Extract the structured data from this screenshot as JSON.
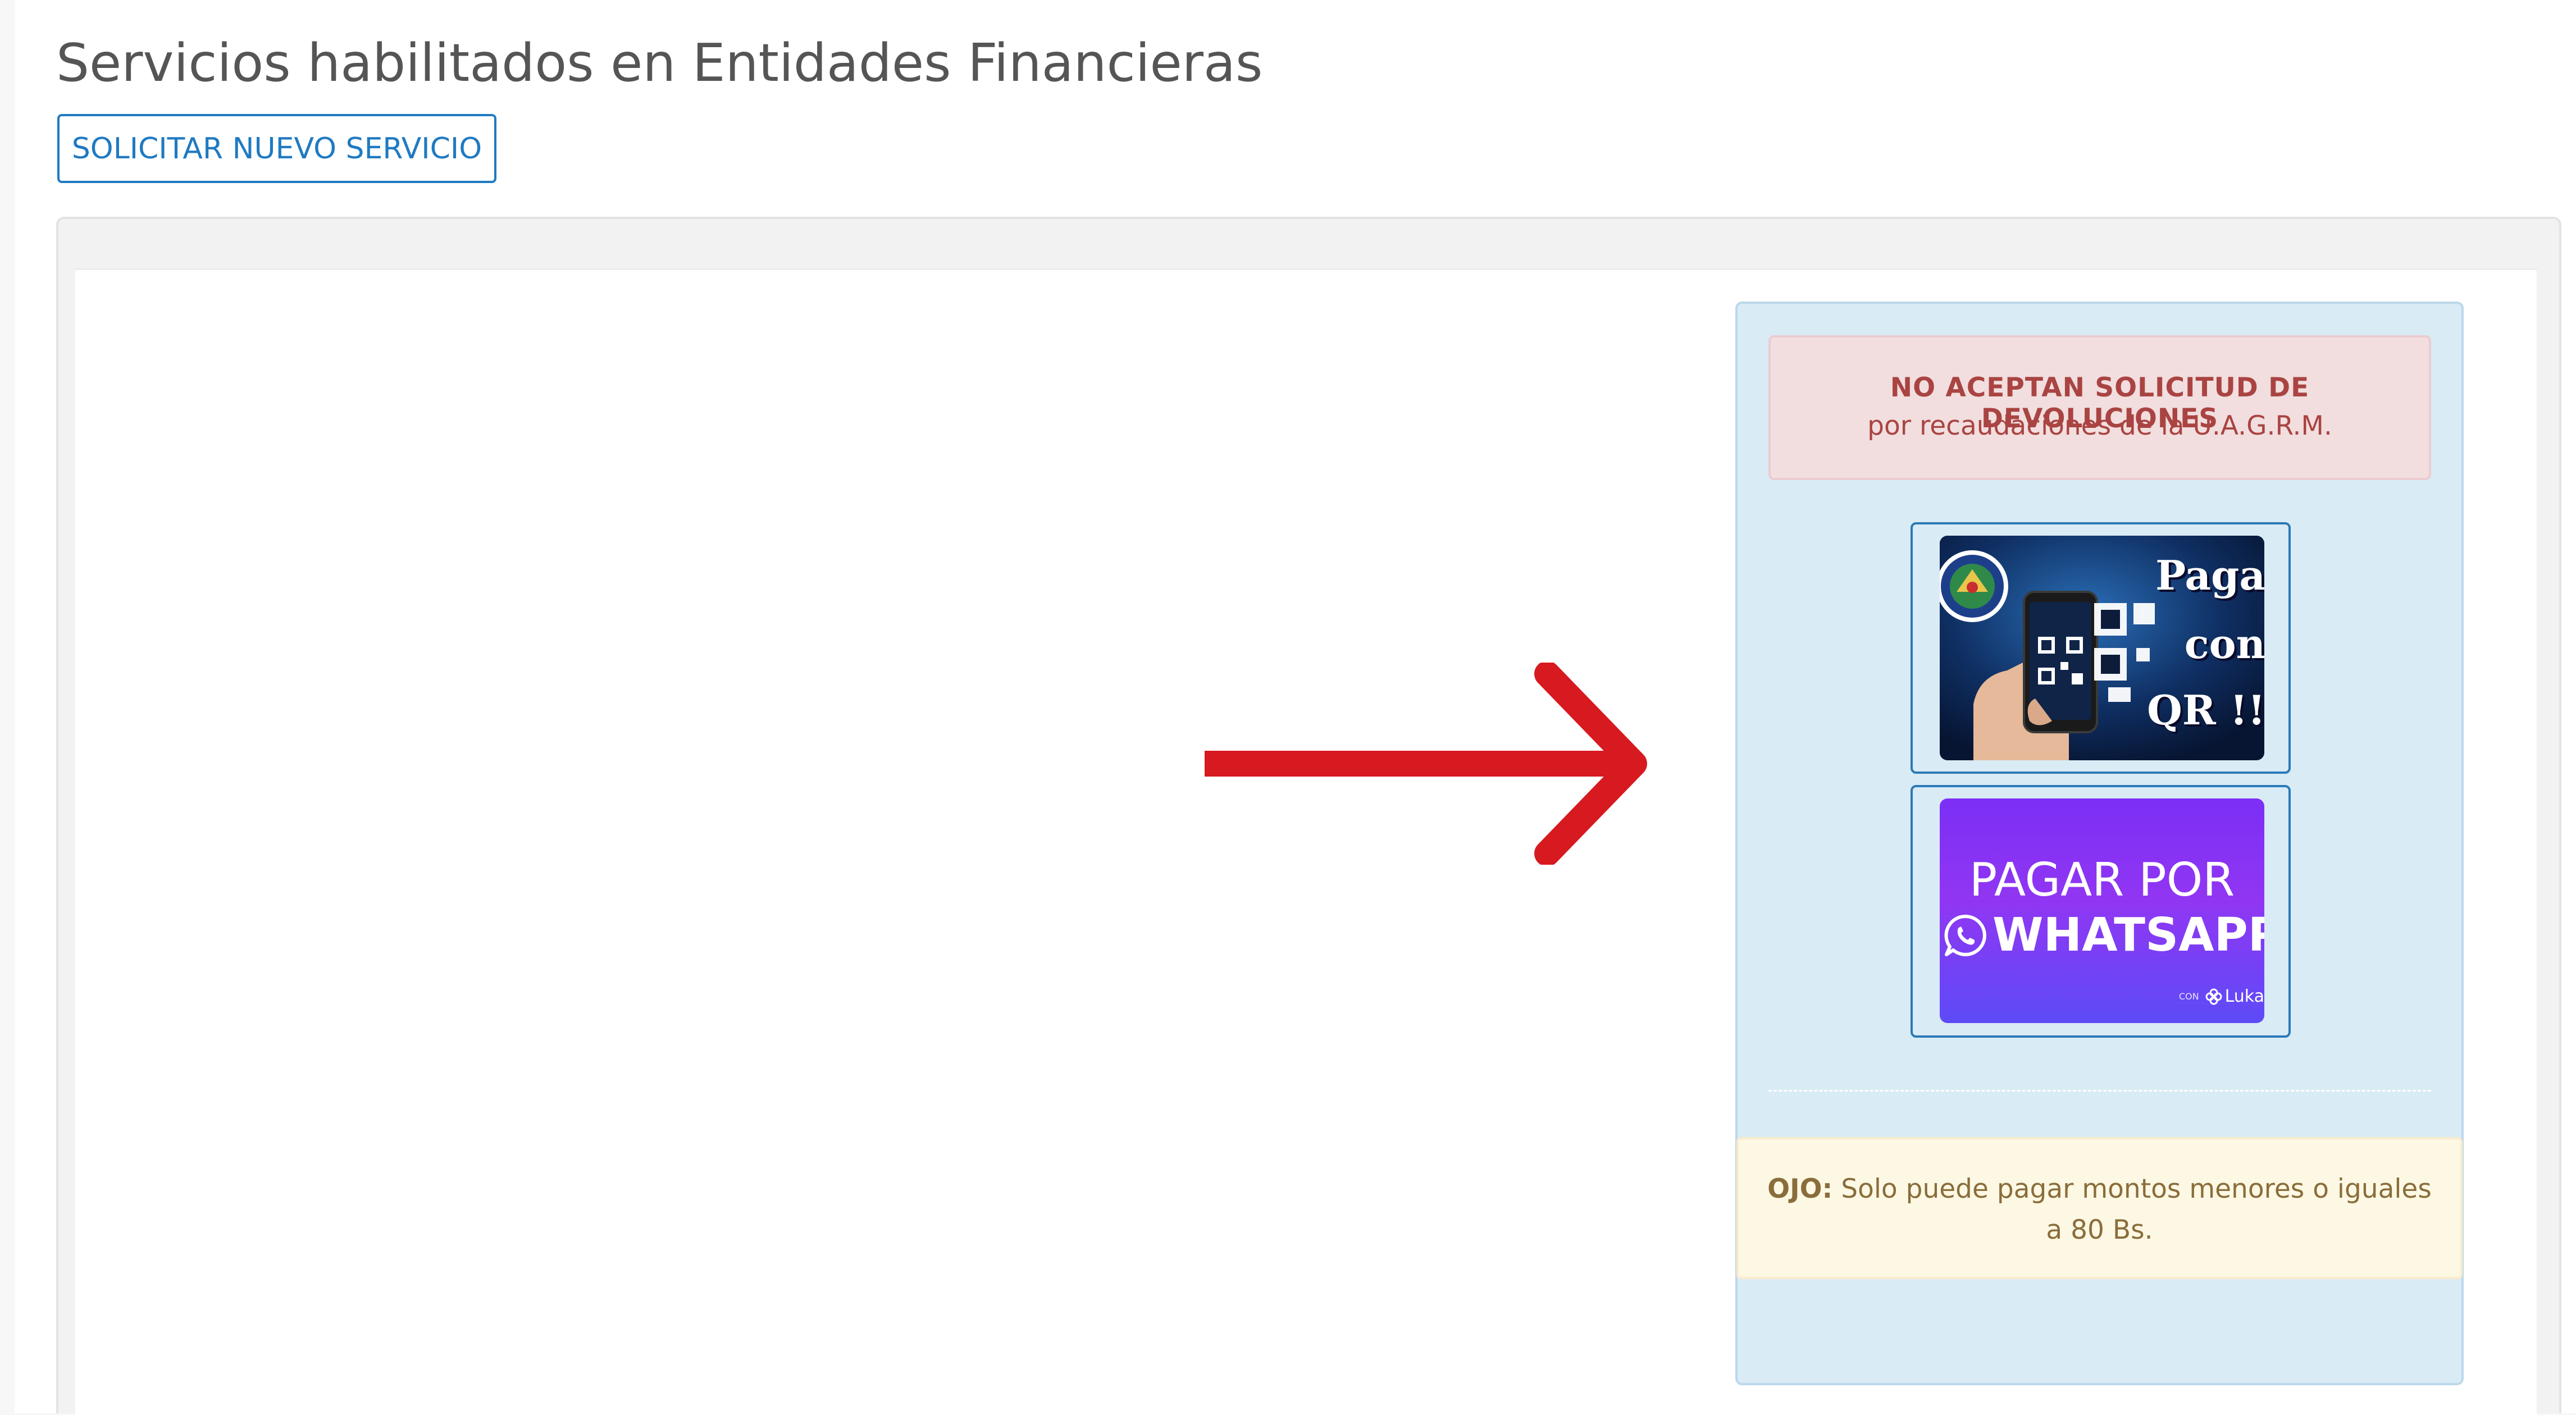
{
  "header": {
    "title": "Servicios habilitados en Entidades Financieras",
    "new_service_button": "SOLICITAR NUEVO SERVICIO"
  },
  "sidebar": {
    "danger_alert": {
      "title": "NO ACEPTAN SOLICITUD DE DEVOLUCIONES",
      "text": "por recaudaciones de la U.A.G.R.M."
    },
    "qr_banner": {
      "line1": "Paga",
      "line2": "con",
      "line3": "QR !!"
    },
    "whatsapp_banner": {
      "line1": "PAGAR POR",
      "line2": "WHATSAPP",
      "small_prefix": "CON",
      "brand": "Luka"
    },
    "warning_alert": {
      "label": "OJO:",
      "text": " Solo puede pagar montos menores o iguales a 80 Bs."
    }
  },
  "colors": {
    "annotation_arrow": "#d71920",
    "primary": "#1f7ac2",
    "danger_text": "#a94442",
    "warning_text": "#8a6d3b",
    "sidebar_bg": "#d9ebf5"
  },
  "icons": [
    "annotation-arrow-icon",
    "university-seal-icon",
    "phone-qr-icon",
    "whatsapp-icon",
    "luka-flower-icon"
  ]
}
